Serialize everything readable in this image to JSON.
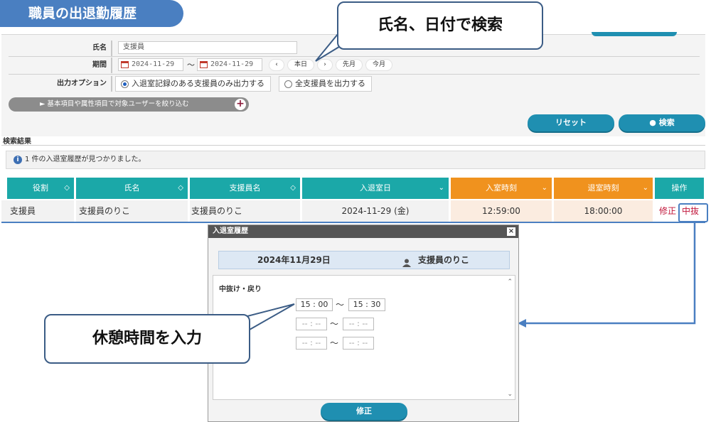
{
  "page_title": "職員の出退勤履歴",
  "callouts": {
    "search": "氏名、日付で検索",
    "rest": "休憩時間を入力"
  },
  "search": {
    "name_label": "氏名",
    "name_value": "支援員",
    "period_label": "期間",
    "date_from": "2024-11-29",
    "date_to": "2024-11-29",
    "tilde": "～",
    "prev": "‹",
    "today": "本日",
    "next": "›",
    "last_month": "先月",
    "this_month": "今月",
    "option_label": "出力オプション",
    "option1": "入退室記録のある支援員のみ出力する",
    "option2": "全支援員を出力する",
    "filter": "► 基本項目や属性項目で対象ユーザーを絞り込む",
    "filter_plus": "+",
    "reset": "リセット",
    "search_btn": "● 検索"
  },
  "results": {
    "label": "検索結果",
    "notice": "1 件の入退室履歴が見つかりました。",
    "info_icon": "i",
    "headers": [
      "役割",
      "氏名",
      "支援員名",
      "入退室日",
      "入室時刻",
      "退室時刻",
      "操作"
    ],
    "row": [
      "支援員",
      "支援員のりこ",
      "支援員のりこ",
      "2024-11-29 (金)",
      "12:59:00",
      "18:00:00"
    ],
    "edit": "修正",
    "break": "中抜"
  },
  "modal": {
    "title": "入退室履歴",
    "close": "×",
    "date": "2024年11月29日",
    "staff": "支援員のりこ",
    "section": "中抜け・戻り",
    "slots": [
      {
        "from": "15 : 00",
        "to": "15 : 30"
      },
      {
        "from": "-- : --",
        "to": "-- : --"
      },
      {
        "from": "-- : --",
        "to": "-- : --"
      }
    ],
    "tilde": "～",
    "save": "修正"
  },
  "colors": {
    "accent": "#4a7fc1",
    "header_teal": "#1ba8a8",
    "header_orange": "#f0921e",
    "button": "#1f8fb1",
    "link_red": "#c0153a"
  }
}
